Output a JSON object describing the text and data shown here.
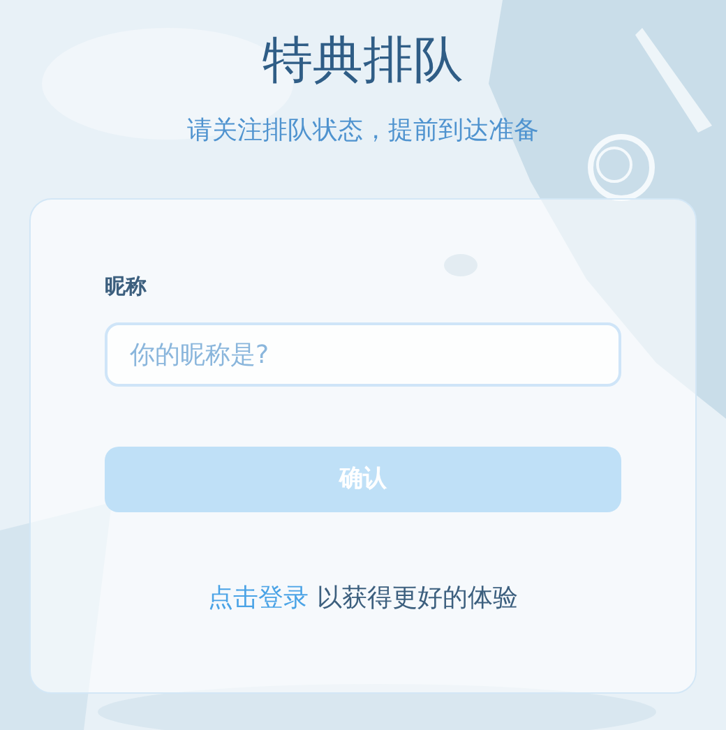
{
  "header": {
    "title": "特典排队",
    "subtitle": "请关注排队状态，提前到达准备"
  },
  "form": {
    "label": "昵称",
    "nickname_field": {
      "placeholder": "你的昵称是?"
    },
    "confirm_button": {
      "label": "确认",
      "disabled": true
    }
  },
  "footer": {
    "login_link": "点击登录",
    "text": "以获得更好的体验"
  }
}
